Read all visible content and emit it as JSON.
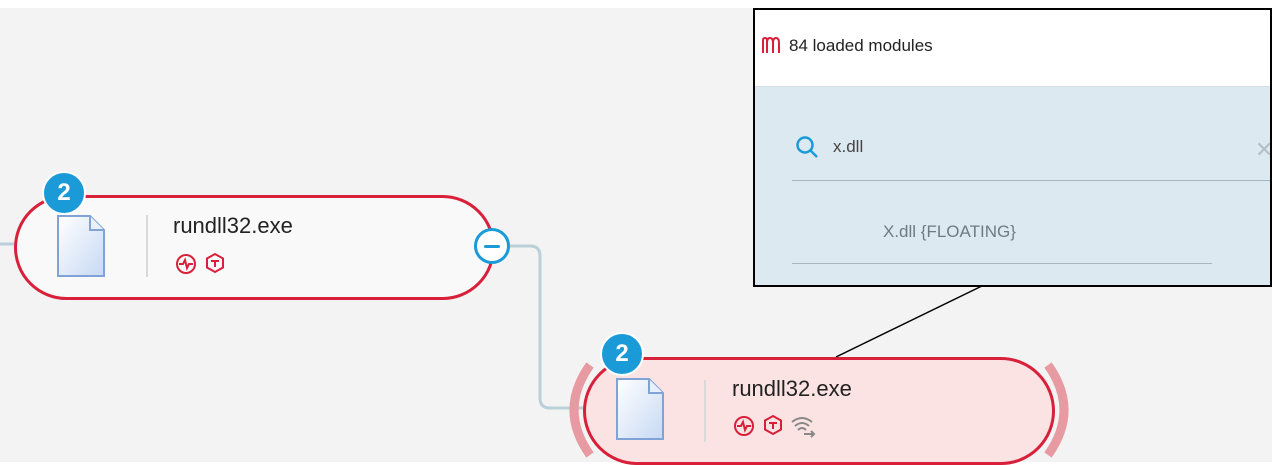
{
  "colors": {
    "node_border": "#d8203a",
    "badge": "#1a9bd7",
    "connector": "#b9d0d8",
    "halo": "#e89aa2",
    "selected_fill": "#fbe3e3",
    "popup_bg": "#dde9f0"
  },
  "nodes": [
    {
      "badge": "2",
      "name": "rundll32.exe",
      "icons": [
        "file-icon",
        "activity-icon",
        "shield-icon"
      ],
      "controls": [
        "collapse-icon"
      ]
    },
    {
      "badge": "2",
      "name": "rundll32.exe",
      "selected": true,
      "icons": [
        "file-icon",
        "activity-icon",
        "shield-icon",
        "network-icon"
      ]
    }
  ],
  "popup": {
    "header_icon": "modules-icon",
    "header": "84 loaded modules",
    "search": {
      "icon": "search-icon",
      "value": "x.dll",
      "clear_icon": "close-icon"
    },
    "results": [
      "X.dll {FLOATING}"
    ]
  }
}
